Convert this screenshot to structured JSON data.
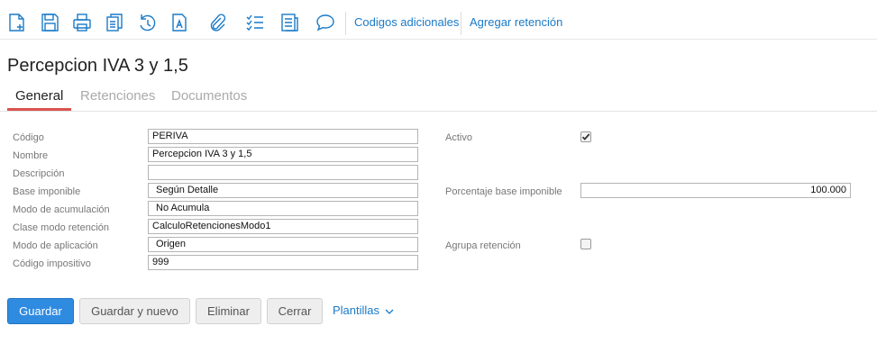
{
  "toolbar": {
    "icons": [
      "new-document-icon",
      "save-icon",
      "print-icon",
      "copy-icon",
      "history-icon",
      "text-document-icon",
      "attachment-icon",
      "checklist-icon",
      "notes-icon",
      "comment-icon"
    ],
    "links": [
      "Codigos adicionales",
      "Agregar retención"
    ],
    "accent_color": "#1a7ac8"
  },
  "page": {
    "title": "Percepcion IVA 3 y 1,5"
  },
  "tabs": [
    {
      "label": "General",
      "active": true
    },
    {
      "label": "Retenciones",
      "active": false
    },
    {
      "label": "Documentos",
      "active": false
    }
  ],
  "form": {
    "left": [
      {
        "label": "Código",
        "value": "PERIVA"
      },
      {
        "label": "Nombre",
        "value": "Percepcion IVA 3 y 1,5"
      },
      {
        "label": "Descripción",
        "value": ""
      },
      {
        "label": "Base imponible",
        "value": "Según Detalle"
      },
      {
        "label": "Modo de acumulación",
        "value": "No Acumula"
      },
      {
        "label": "Clase modo retención",
        "value": "CalculoRetencionesModo1"
      },
      {
        "label": "Modo de aplicación",
        "value": "Origen"
      },
      {
        "label": "Código impositivo",
        "value": "999"
      }
    ],
    "right": {
      "activo": {
        "label": "Activo",
        "checked": true
      },
      "porcentaje": {
        "label": "Porcentaje base imponible",
        "value": "100.000"
      },
      "agrupa": {
        "label": "Agrupa retención",
        "checked": false
      }
    }
  },
  "actions": {
    "guardar": "Guardar",
    "guardar_nuevo": "Guardar y nuevo",
    "eliminar": "Eliminar",
    "cerrar": "Cerrar",
    "plantillas": "Plantillas",
    "primary_color": "#2f8be0"
  }
}
